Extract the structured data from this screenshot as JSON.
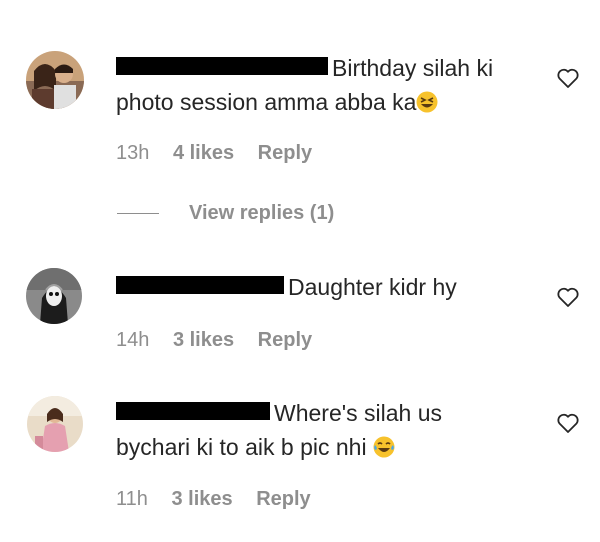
{
  "comments": [
    {
      "text_line1": "Birthday silah ki",
      "text_line2": "photo session amma abba ka",
      "emoji": "laughing-squint-emoji",
      "time": "13h",
      "likes": "4 likes",
      "reply": "Reply"
    },
    {
      "text_line1": "Daughter kidr hy",
      "time": "14h",
      "likes": "3 likes",
      "reply": "Reply"
    },
    {
      "text_line1": "Where's silah us",
      "text_line2": "bychari ki to aik b pic nhi",
      "emoji": "tears-of-joy-emoji",
      "time": "11h",
      "likes": "3 likes",
      "reply": "Reply"
    }
  ],
  "view_replies": "View replies (1)",
  "icons": {
    "like": "heart-outline-icon"
  },
  "colors": {
    "text": "#262626",
    "meta": "#8e8e8e",
    "redaction": "#000000"
  }
}
